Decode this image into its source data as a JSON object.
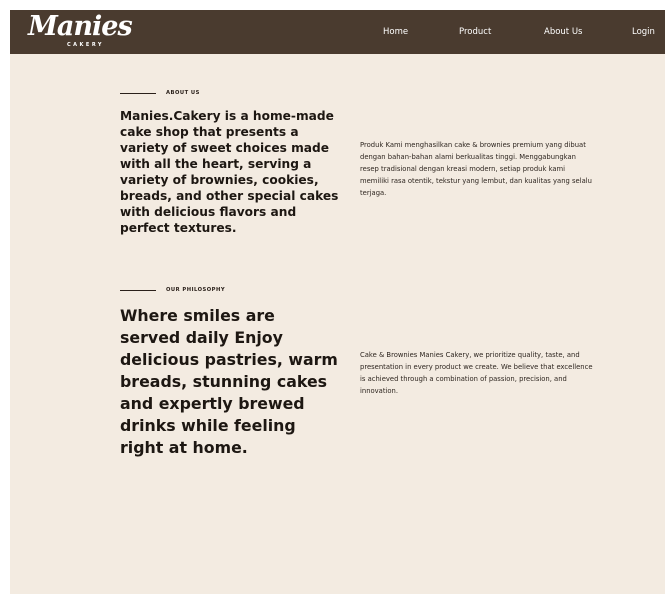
{
  "brand": {
    "name": "Manies",
    "tagline": "CAKERY"
  },
  "nav": {
    "items": [
      {
        "id": "home",
        "label": "Home"
      },
      {
        "id": "product",
        "label": "Product"
      },
      {
        "id": "about",
        "label": "About Us"
      },
      {
        "id": "login",
        "label": "Login"
      }
    ]
  },
  "about": {
    "eyebrow": "ABOUT US",
    "heading": "Manies.Cakery is a home-made cake shop that presents a variety of sweet choices made with all the heart, serving a variety of brownies, cookies, breads, and other special cakes with delicious flavors and perfect textures.",
    "body": "Produk Kami menghasilkan cake & brownies premium yang dibuat dengan bahan-bahan alami berkualitas tinggi. Menggabungkan resep tradisional dengan kreasi modern, setiap produk kami memiliki rasa otentik, tekstur yang lembut, dan kualitas yang selalu terjaga."
  },
  "philosophy": {
    "eyebrow": "OUR PHILOSOPHY",
    "heading": "Where smiles are served daily Enjoy delicious pastries, warm breads, stunning cakes and expertly brewed drinks while feeling right at home.",
    "body": "Cake & Brownies Manies Cakery, we prioritize quality, taste, and presentation in every product we create. We believe that excellence is achieved through a combination of passion, precision, and innovation."
  },
  "colors": {
    "nav_bg": "#4a3b2f",
    "page_bg": "#f3ebe1",
    "text_dark": "#1d1712"
  }
}
